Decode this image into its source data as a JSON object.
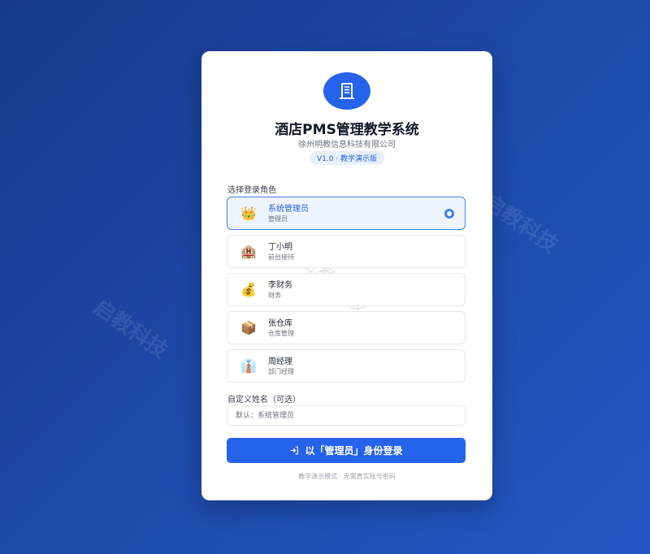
{
  "watermark": {
    "text": "启教科技"
  },
  "header": {
    "title": "酒店PMS管理教学系统",
    "subtitle": "徐州明教信息科技有限公司",
    "version": "V1.0 · 教学演示版"
  },
  "roles_section": {
    "label": "选择登录角色",
    "items": [
      {
        "name": "系统管理员",
        "desc": "管理员",
        "icon": "crown-icon",
        "emoji": "👑",
        "selected": true
      },
      {
        "name": "丁小明",
        "desc": "前台接待",
        "icon": "hotel-icon",
        "emoji": "🏨",
        "selected": false
      },
      {
        "name": "李财务",
        "desc": "财务",
        "icon": "money-bag-icon",
        "emoji": "💰",
        "selected": false
      },
      {
        "name": "张仓库",
        "desc": "仓库管理",
        "icon": "package-icon",
        "emoji": "📦",
        "selected": false
      },
      {
        "name": "周经理",
        "desc": "部门经理",
        "icon": "suit-icon",
        "emoji": "👔",
        "selected": false
      }
    ]
  },
  "custom_name": {
    "label": "自定义姓名（可选）",
    "placeholder": "默认：系统管理员",
    "value": ""
  },
  "login_button": {
    "label": "以「管理员」身份登录",
    "icon": "login-icon"
  },
  "footer": {
    "note": "教学演示模式 · 无需真实账号密码"
  },
  "colors": {
    "primary": "#2563eb",
    "bg": "#1d4aa8"
  }
}
